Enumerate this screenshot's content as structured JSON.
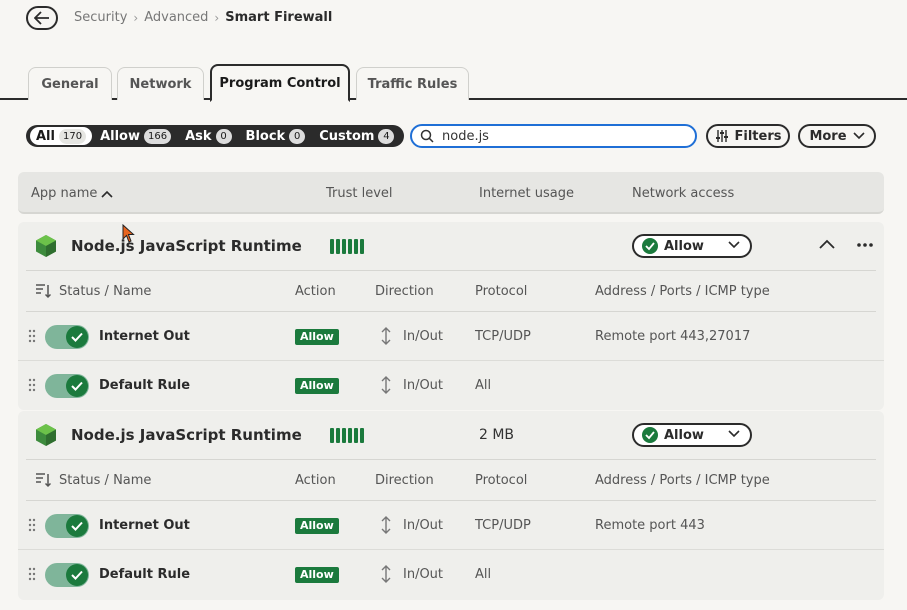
{
  "breadcrumb": {
    "items": [
      "Security",
      "Advanced"
    ],
    "current": "Smart Firewall"
  },
  "tabs": [
    {
      "label": "General"
    },
    {
      "label": "Network"
    },
    {
      "label": "Program Control"
    },
    {
      "label": "Traffic Rules"
    }
  ],
  "filters": [
    {
      "label": "All",
      "count": "170"
    },
    {
      "label": "Allow",
      "count": "166"
    },
    {
      "label": "Ask",
      "count": "0"
    },
    {
      "label": "Block",
      "count": "0"
    },
    {
      "label": "Custom",
      "count": "4"
    }
  ],
  "search": {
    "value": "node.js",
    "placeholder": ""
  },
  "toolbar": {
    "filters_label": "Filters",
    "more_label": "More"
  },
  "table": {
    "columns": {
      "app_name": "App name",
      "trust": "Trust level",
      "usage": "Internet usage",
      "access": "Network access"
    }
  },
  "rule_columns": {
    "status_name": "Status / Name",
    "action": "Action",
    "direction": "Direction",
    "protocol": "Protocol",
    "address": "Address / Ports / ICMP type"
  },
  "groups": [
    {
      "name": "Node.js JavaScript Runtime",
      "usage": "",
      "access": "Allow",
      "rules": [
        {
          "name": "Internet Out",
          "action": "Allow",
          "direction": "In/Out",
          "protocol": "TCP/UDP",
          "address": "Remote port 443,27017"
        },
        {
          "name": "Default Rule",
          "action": "Allow",
          "direction": "In/Out",
          "protocol": "All",
          "address": ""
        }
      ]
    },
    {
      "name": "Node.js JavaScript Runtime",
      "usage": "2 MB",
      "access": "Allow",
      "rules": [
        {
          "name": "Internet Out",
          "action": "Allow",
          "direction": "In/Out",
          "protocol": "TCP/UDP",
          "address": "Remote port 443"
        },
        {
          "name": "Default Rule",
          "action": "Allow",
          "direction": "In/Out",
          "protocol": "All",
          "address": ""
        }
      ]
    }
  ],
  "colors": {
    "accent_green": "#1b7a3d",
    "focus_blue": "#1f6fd6",
    "dark": "#2b2b2b"
  },
  "icons": [
    "back-arrow-icon",
    "search-icon",
    "filters-icon",
    "chevron-down-icon",
    "sort-asc-icon",
    "node-icon",
    "chevron-up-icon",
    "more-dots-icon",
    "sort-icon",
    "drag-handle-icon",
    "check-icon",
    "direction-icon"
  ]
}
